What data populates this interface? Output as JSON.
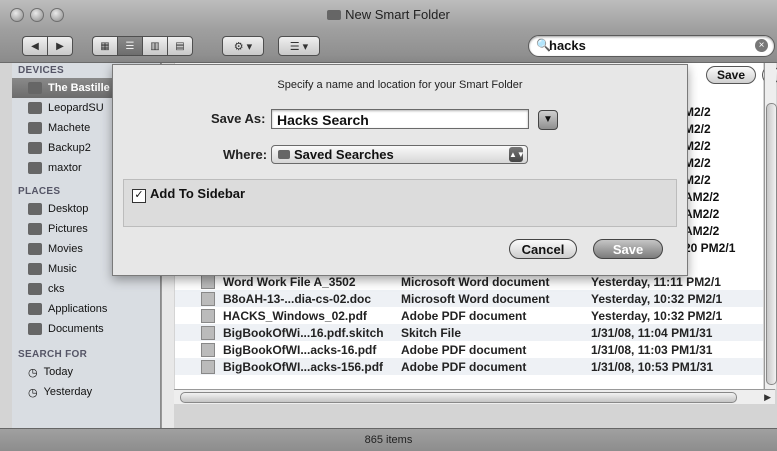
{
  "window": {
    "title": "New Smart Folder",
    "status": "865 items"
  },
  "toolbar": {
    "search_query": "hacks",
    "save_label": "Save",
    "add_label": "+",
    "view_buttons": [
      "icon-view",
      "list-view",
      "column-view",
      "cover-flow-view"
    ]
  },
  "sidebar": {
    "devices_header": "DEVICES",
    "devices": [
      "The Bastille",
      "LeopardSU",
      "Machete",
      "Backup2",
      "maxtor"
    ],
    "places_header": "PLACES",
    "places": [
      "Desktop",
      "Pictures",
      "Movies",
      "Music",
      "cks",
      "Applications",
      "Documents"
    ],
    "search_header": "SEARCH FOR",
    "search_for": [
      "Today",
      "Yesterday"
    ]
  },
  "dates_partial": [
    "M2/2",
    "M2/2",
    "M2/2",
    "M2/2",
    "M2/2",
    "AM2/2",
    "AM2/2",
    "AM2/2",
    "20 PM2/1"
  ],
  "files": [
    {
      "name": "Word Work File A_3502",
      "kind": "Microsoft Word document",
      "date": "Yesterday, 11:11 PM2/1"
    },
    {
      "name": "B8oAH-13-...dia-cs-02.doc",
      "kind": "Microsoft Word document",
      "date": "Yesterday, 10:32 PM2/1"
    },
    {
      "name": "HACKS_Windows_02.pdf",
      "kind": "Adobe PDF document",
      "date": "Yesterday, 10:32 PM2/1"
    },
    {
      "name": "BigBookOfWi...16.pdf.skitch",
      "kind": "Skitch File",
      "date": "1/31/08, 11:04 PM1/31"
    },
    {
      "name": "BigBookOfWI...acks-16.pdf",
      "kind": "Adobe PDF document",
      "date": "1/31/08, 11:03 PM1/31"
    },
    {
      "name": "BigBookOfWI...acks-156.pdf",
      "kind": "Adobe PDF document",
      "date": "1/31/08, 10:53 PM1/31"
    }
  ],
  "dialog": {
    "heading": "Specify a name and location for your Smart Folder",
    "save_as_label": "Save As:",
    "save_as_value": "Hacks Search",
    "where_label": "Where:",
    "where_value": "Saved Searches",
    "add_to_sidebar_label": "Add To Sidebar",
    "add_to_sidebar_checked": true,
    "cancel_label": "Cancel",
    "save_label": "Save"
  }
}
